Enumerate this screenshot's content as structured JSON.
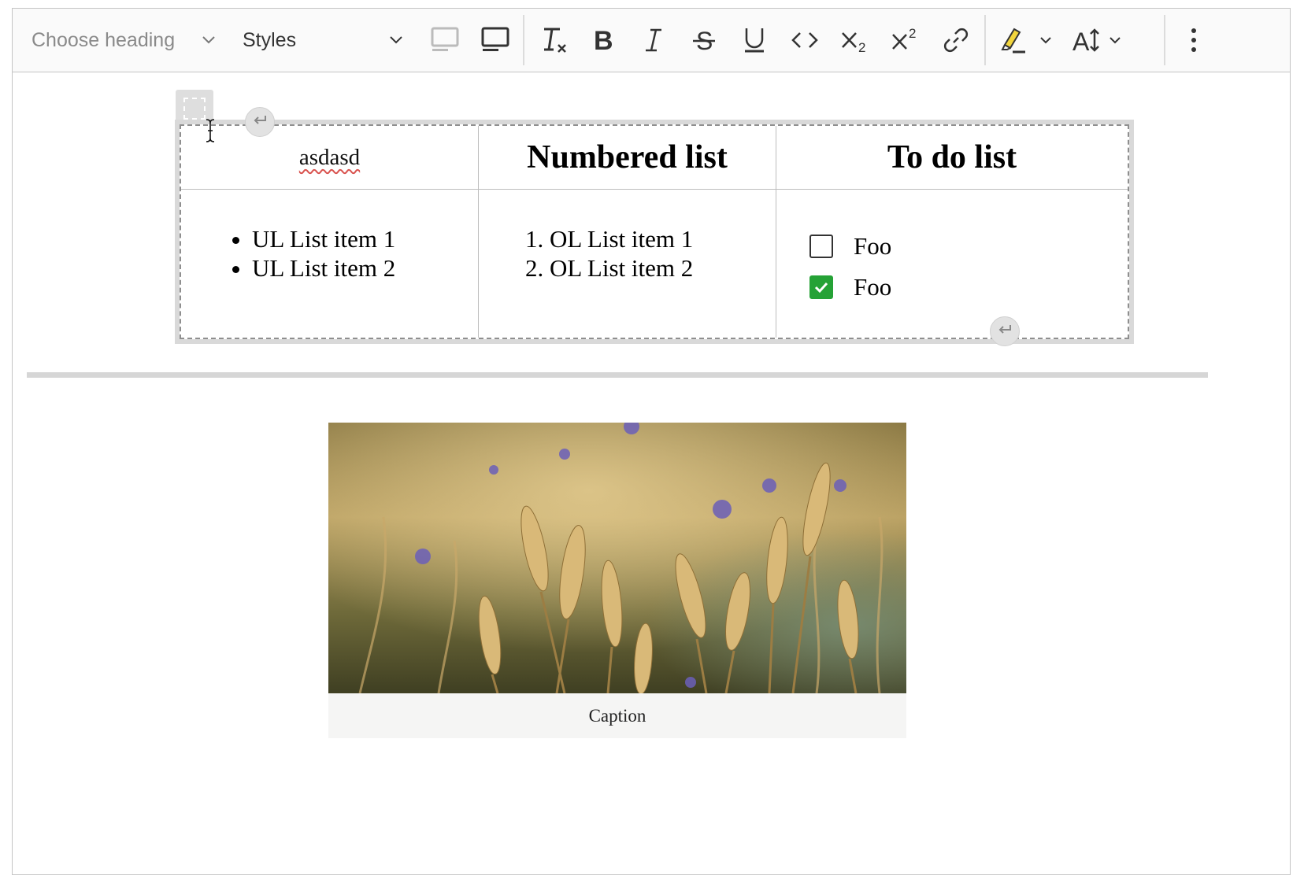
{
  "toolbar": {
    "heading_dropdown": {
      "placeholder": "Choose heading"
    },
    "styles_dropdown": {
      "label": "Styles"
    },
    "buttons": [
      {
        "name": "align-left-icon"
      },
      {
        "name": "align-center-icon"
      },
      {
        "name": "remove-format-icon"
      },
      {
        "name": "bold-icon"
      },
      {
        "name": "italic-icon"
      },
      {
        "name": "strikethrough-icon"
      },
      {
        "name": "underline-icon"
      },
      {
        "name": "code-icon"
      },
      {
        "name": "subscript-icon"
      },
      {
        "name": "superscript-icon"
      },
      {
        "name": "link-icon"
      },
      {
        "name": "highlight-icon"
      },
      {
        "name": "font-size-icon"
      },
      {
        "name": "more-vertical-icon"
      }
    ]
  },
  "table": {
    "headers": [
      "asdasd",
      "Numbered list",
      "To do list"
    ],
    "bulleted_list": [
      "UL List item 1",
      "UL List item 2"
    ],
    "numbered_list": [
      "OL List item 1",
      "OL List item 2"
    ],
    "todo_list": [
      {
        "label": "Foo",
        "checked": false
      },
      {
        "label": "Foo",
        "checked": true
      }
    ]
  },
  "image": {
    "caption": "Caption",
    "alt_subject": "wheat field"
  },
  "colors": {
    "checkbox_checked": "#25a236",
    "spellcheck_underline": "#d9534f",
    "highlight_marker": "#f2d53c"
  }
}
